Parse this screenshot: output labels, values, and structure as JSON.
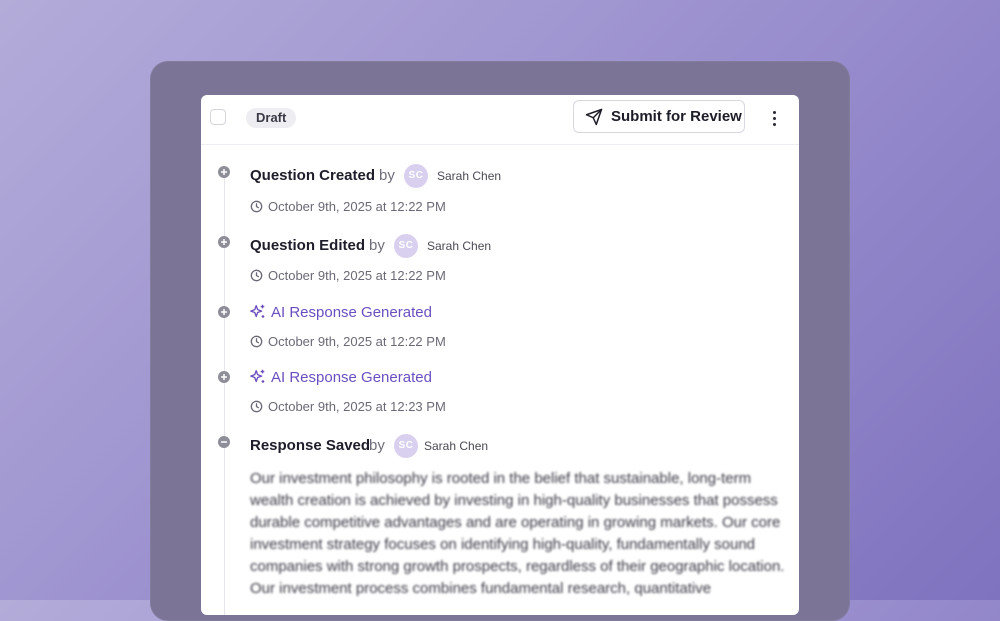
{
  "header": {
    "status_badge": "Draft",
    "submit_label": "Submit for Review"
  },
  "timeline": [
    {
      "title": "Question Created",
      "by": "by",
      "avatar_initials": "SC",
      "user": "Sarah Chen",
      "timestamp": "October 9th, 2025 at 12:22 PM"
    },
    {
      "title": "Question Edited",
      "by": "by",
      "avatar_initials": "SC",
      "user": "Sarah Chen",
      "timestamp": "October 9th, 2025 at 12:22 PM"
    },
    {
      "title": "AI Response Generated",
      "timestamp": "October 9th, 2025 at 12:22 PM"
    },
    {
      "title": "AI Response Generated",
      "timestamp": "October 9th, 2025 at 12:23 PM"
    },
    {
      "title": "Response Saved",
      "by": "by",
      "avatar_initials": "SC",
      "user": "Sarah Chen",
      "response_text": "Our investment philosophy is rooted in the belief that sustainable, long-term wealth creation is achieved by investing in high-quality businesses that possess durable competitive advantages and are operating in growing markets. Our core investment strategy focuses on identifying high-quality, fundamentally sound companies with strong growth prospects, regardless of their geographic location. Our investment process combines fundamental research, quantitative"
    }
  ],
  "colors": {
    "accent_purple": "#6b4fc1",
    "avatar_bg": "#d9d0f0",
    "frame": "#7b7497"
  },
  "icons": {
    "submit": "send-icon",
    "ai": "sparkle-icon",
    "expand": "plus-circle-icon",
    "collapse": "minus-circle-icon",
    "time": "clock-icon",
    "more": "kebab-menu-icon"
  }
}
